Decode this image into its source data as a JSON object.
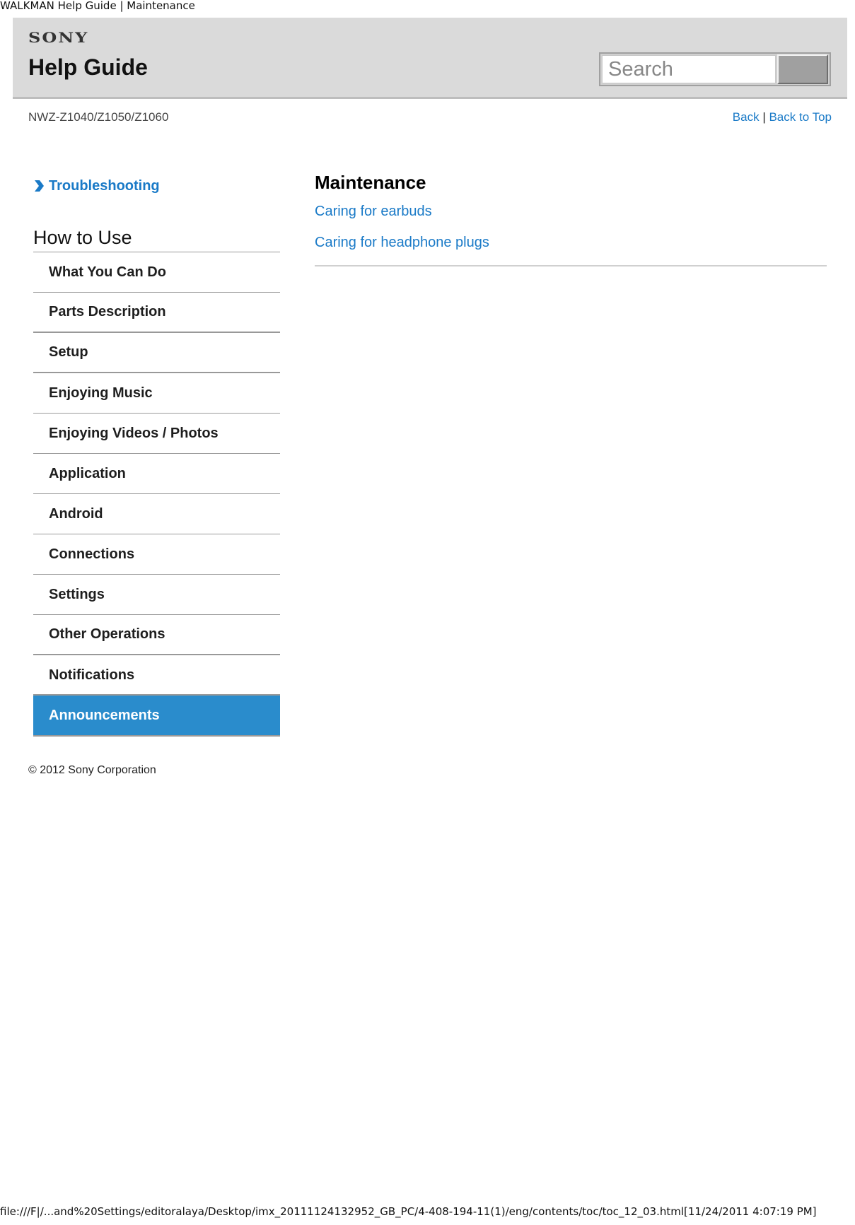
{
  "document": {
    "title": "WALKMAN Help Guide | Maintenance",
    "footer_path": "file:///F|/...and%20Settings/editoralaya/Desktop/imx_20111124132952_GB_PC/4-408-194-11(1)/eng/contents/toc/toc_12_03.html[11/24/2011 4:07:19 PM]"
  },
  "header": {
    "brand": "SONY",
    "title": "Help Guide",
    "search": {
      "placeholder": "Search",
      "value": ""
    },
    "search_button_label": ""
  },
  "subheader": {
    "model": "NWZ-Z1040/Z1050/Z1060",
    "back_label": "Back",
    "separator": "|",
    "back_to_top_label": "Back to Top"
  },
  "sidebar": {
    "troubleshooting_label": "Troubleshooting",
    "section_title": "How to Use",
    "items": [
      {
        "label": "What You Can Do",
        "active": false
      },
      {
        "label": "Parts Description",
        "active": false
      },
      {
        "label": "Setup",
        "active": false
      },
      {
        "label": "Enjoying Music",
        "active": false
      },
      {
        "label": "Enjoying Videos / Photos",
        "active": false
      },
      {
        "label": "Application",
        "active": false
      },
      {
        "label": "Android",
        "active": false
      },
      {
        "label": "Connections",
        "active": false
      },
      {
        "label": "Settings",
        "active": false
      },
      {
        "label": "Other Operations",
        "active": false
      },
      {
        "label": "Notifications",
        "active": false
      },
      {
        "label": "Announcements",
        "active": true
      }
    ],
    "copyright": "© 2012 Sony Corporation"
  },
  "main": {
    "heading": "Maintenance",
    "links": [
      {
        "label": "Caring for earbuds"
      },
      {
        "label": "Caring for headphone plugs"
      }
    ]
  },
  "colors": {
    "link": "#1a7ac7",
    "active_nav": "#2a8ccc",
    "header_bg": "#dadada"
  }
}
